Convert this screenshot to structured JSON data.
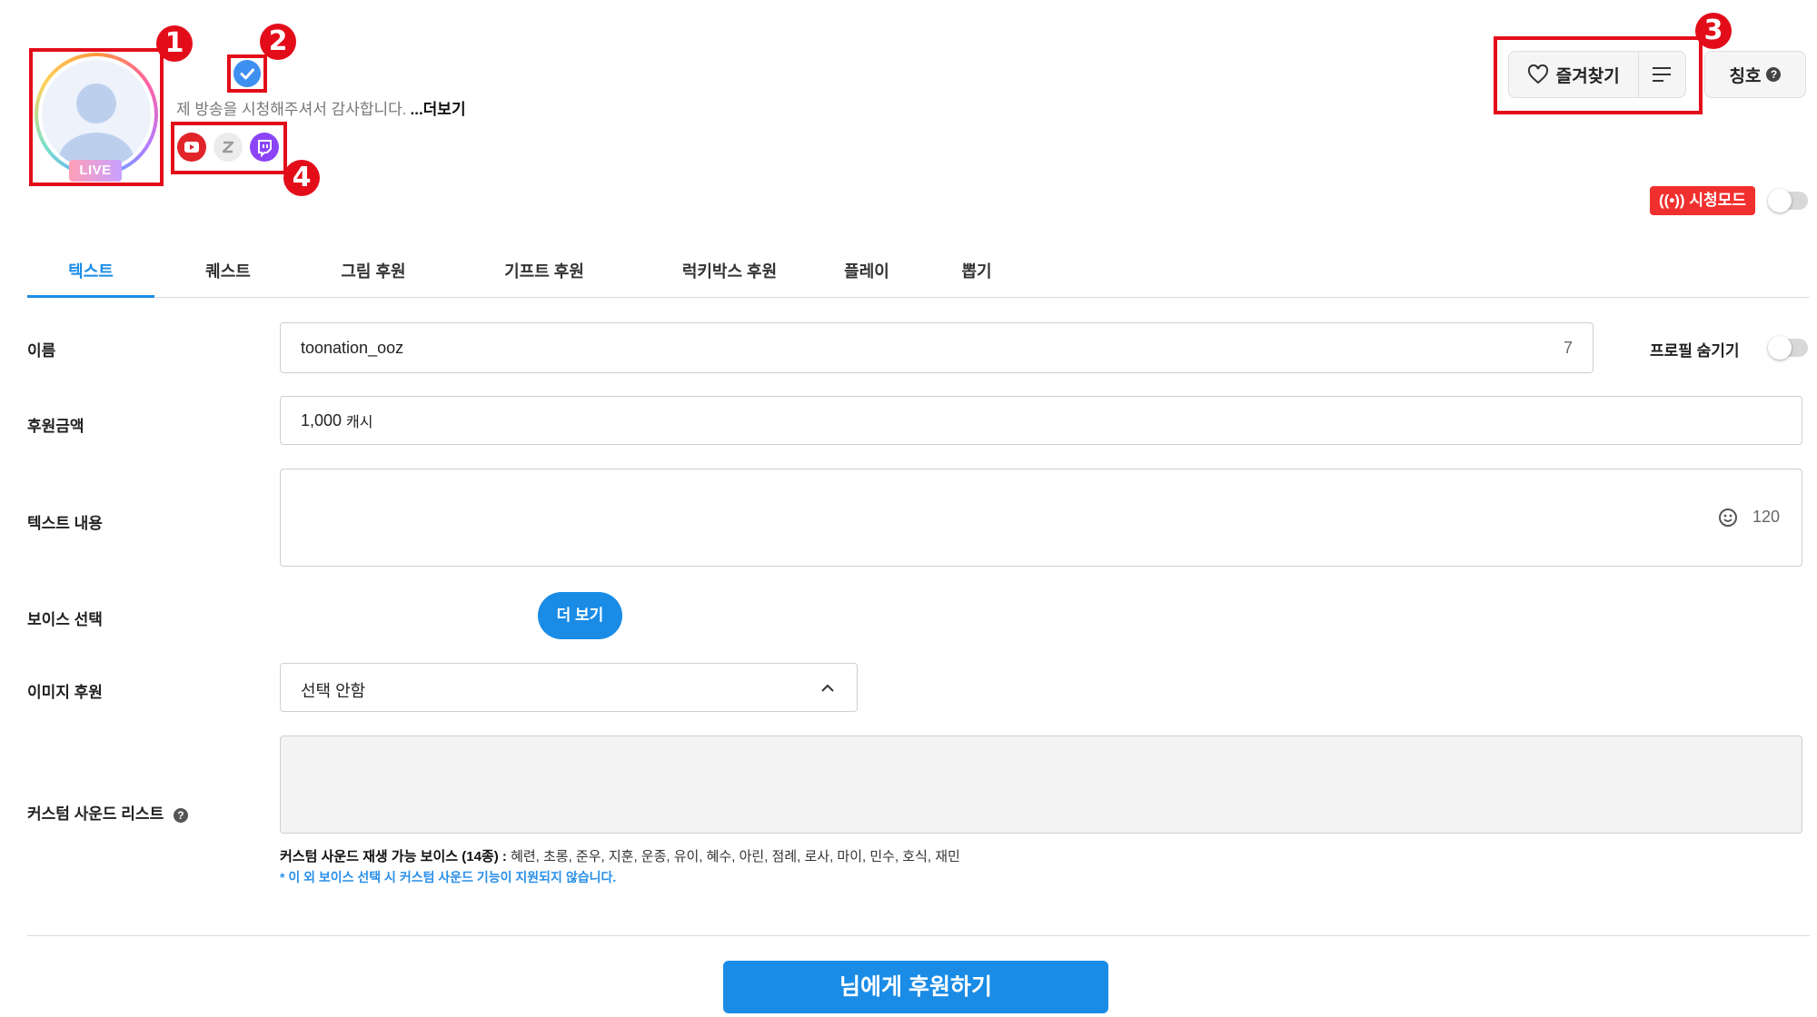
{
  "profile": {
    "live_badge": "LIVE",
    "bio": "제 방송을 시청해주셔서 감사합니다.",
    "bio_more": "...더보기",
    "social_icons": [
      "youtube-icon",
      "zepeto-icon",
      "twitch-icon"
    ]
  },
  "annotations": [
    "1",
    "2",
    "3",
    "4"
  ],
  "header": {
    "favorites_label": "즐겨찾기",
    "title_label": "칭호",
    "help_mark": "?",
    "watch_mode_label": "((•)) 시청모드"
  },
  "tabs": [
    {
      "label": "텍스트",
      "active": true
    },
    {
      "label": "퀘스트"
    },
    {
      "label": "그림 후원"
    },
    {
      "label": "기프트 후원"
    },
    {
      "label": "럭키박스 후원"
    },
    {
      "label": "플레이"
    },
    {
      "label": "뽑기"
    }
  ],
  "form": {
    "name_label": "이름",
    "name_value": "toonation_ooz",
    "name_count": "7",
    "hide_profile_label": "프로필 숨기기",
    "amount_label": "후원금액",
    "amount_value": "1,000",
    "amount_unit": "캐시",
    "text_label": "텍스트 내용",
    "text_limit": "120",
    "voice_label": "보이스 선택",
    "voice_more": "더 보기",
    "image_label": "이미지 후원",
    "image_value": "선택 안함",
    "custom_sound_label": "커스텀 사운드 리스트",
    "voice_note_bold": "커스텀 사운드 재생 가능 보이스 (14종) :",
    "voice_note_list": "혜련, 초롱, 준우, 지훈, 운종, 유이, 혜수, 아린, 점례, 로사, 마이, 민수, 호식, 재민",
    "voice_warning": "* 이 외 보이스 선택 시 커스텀 사운드 기능이 지원되지 않습니다."
  },
  "submit_label": "님에게 후원하기",
  "colors": {
    "accent": "#1a8ce6",
    "annotation": "#e30d1a",
    "watch_mode": "#f0302f"
  }
}
